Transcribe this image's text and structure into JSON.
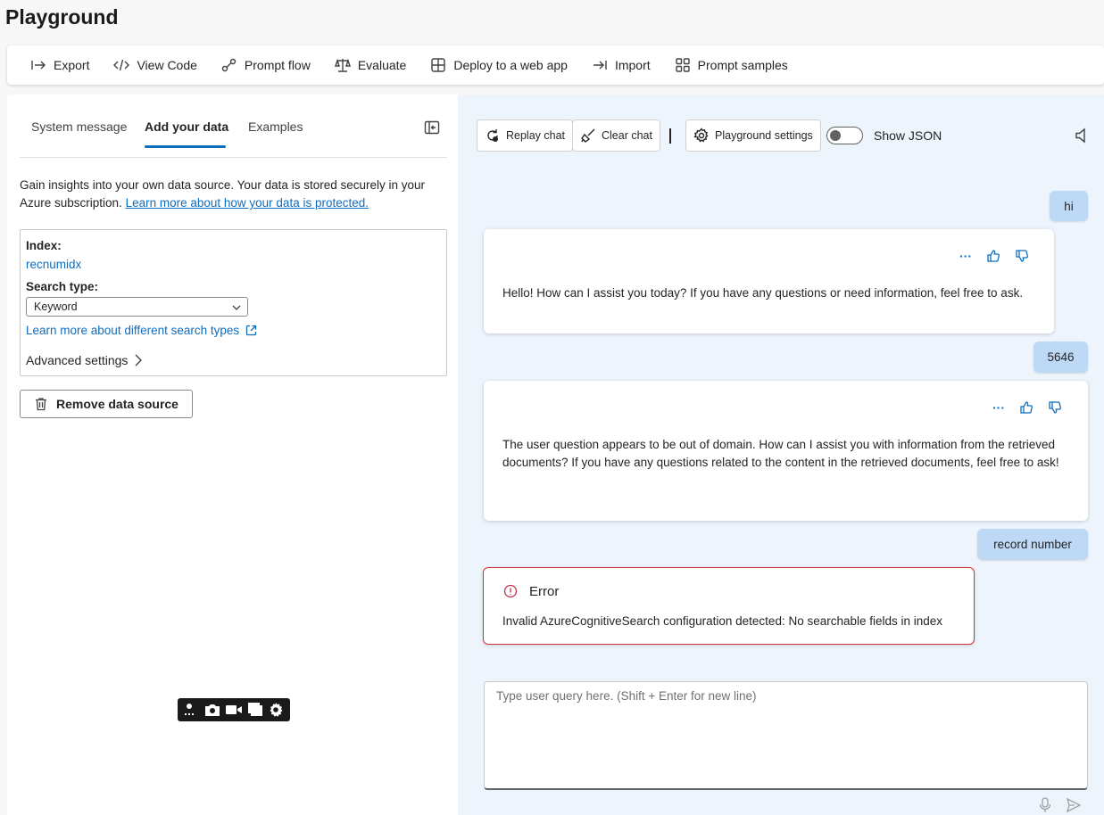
{
  "page": {
    "title": "Playground"
  },
  "toolbar": {
    "items": [
      {
        "label": "Export",
        "icon": "export-icon"
      },
      {
        "label": "View Code",
        "icon": "code-icon"
      },
      {
        "label": "Prompt flow",
        "icon": "flow-icon"
      },
      {
        "label": "Evaluate",
        "icon": "scale-icon"
      },
      {
        "label": "Deploy to a web app",
        "icon": "deploy-icon"
      },
      {
        "label": "Import",
        "icon": "import-icon"
      },
      {
        "label": "Prompt samples",
        "icon": "grid-icon"
      }
    ]
  },
  "setup": {
    "tabs": [
      {
        "label": "System message",
        "active": false
      },
      {
        "label": "Add your data",
        "active": true
      },
      {
        "label": "Examples",
        "active": false
      }
    ],
    "description": "Gain insights into your own data source. Your data is stored securely in your Azure subscription.",
    "description_link": "Learn more about how your data is protected.",
    "index_label": "Index:",
    "index_value": "recnumidx",
    "search_type_label": "Search type:",
    "search_type_value": "Keyword",
    "learn_search_link": "Learn more about different search types",
    "advanced_settings": "Advanced settings",
    "remove_button": "Remove data source"
  },
  "chat": {
    "buttons": {
      "replay": "Replay chat",
      "clear": "Clear chat",
      "settings": "Playground settings"
    },
    "show_json_label": "Show JSON",
    "show_json_on": false,
    "messages": [
      {
        "role": "user",
        "text": "hi"
      },
      {
        "role": "assistant",
        "text": "Hello! How can I assist you today? If you have any questions or need information, feel free to ask."
      },
      {
        "role": "user",
        "text": "5646"
      },
      {
        "role": "assistant",
        "text": "The user question appears to be out of domain. How can I assist you with information from the retrieved documents? If you have any questions related to the content in the retrieved documents, feel free to ask!"
      },
      {
        "role": "user",
        "text": "record number"
      }
    ],
    "error": {
      "title": "Error",
      "message": "Invalid AzureCognitiveSearch configuration detected: No searchable fields in index"
    },
    "input_placeholder": "Type user query here. (Shift + Enter for new line)",
    "input_value": ""
  },
  "colors": {
    "accent": "#0f6cbd",
    "user_bubble": "#bdd9f5",
    "chat_background": "#eef4fb",
    "error_border": "#d13438"
  }
}
